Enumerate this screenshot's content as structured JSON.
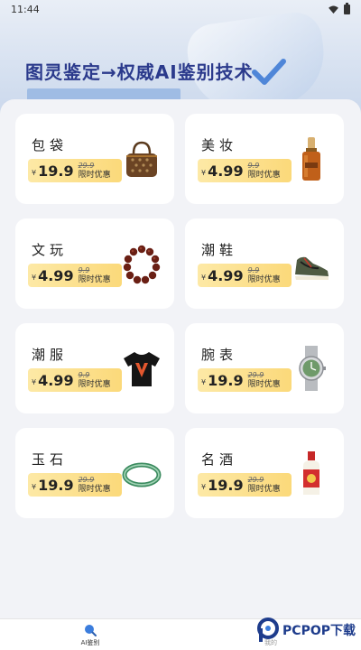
{
  "status_bar": {
    "time": "11:44"
  },
  "banner": {
    "title": "图灵鉴定→权威AI鉴别技术"
  },
  "categories": [
    {
      "name": "包袋",
      "price": "19.9",
      "original_price": "29.9",
      "promo": "限时优惠",
      "currency": "¥",
      "product_icon": "handbag-icon"
    },
    {
      "name": "美妆",
      "price": "4.99",
      "original_price": "9.9",
      "promo": "限时优惠",
      "currency": "¥",
      "product_icon": "serum-bottle-icon"
    },
    {
      "name": "文玩",
      "price": "4.99",
      "original_price": "9.9",
      "promo": "限时优惠",
      "currency": "¥",
      "product_icon": "bead-bracelet-icon"
    },
    {
      "name": "潮鞋",
      "price": "4.99",
      "original_price": "9.9",
      "promo": "限时优惠",
      "currency": "¥",
      "product_icon": "sneaker-icon"
    },
    {
      "name": "潮服",
      "price": "4.99",
      "original_price": "9.9",
      "promo": "限时优惠",
      "currency": "¥",
      "product_icon": "tshirt-icon"
    },
    {
      "name": "腕表",
      "price": "19.9",
      "original_price": "29.9",
      "promo": "限时优惠",
      "currency": "¥",
      "product_icon": "wristwatch-icon"
    },
    {
      "name": "玉石",
      "price": "19.9",
      "original_price": "29.9",
      "promo": "限时优惠",
      "currency": "¥",
      "product_icon": "jade-bangle-icon"
    },
    {
      "name": "名酒",
      "price": "19.9",
      "original_price": "29.9",
      "promo": "限时优惠",
      "currency": "¥",
      "product_icon": "liquor-bottle-icon"
    }
  ],
  "bottom_nav": {
    "items": [
      {
        "label": "AI鉴别",
        "icon": "search-icon",
        "active": true
      },
      {
        "label": "我的",
        "icon": "profile-icon",
        "active": false
      }
    ]
  },
  "watermark": {
    "text": "PCPOP下载"
  },
  "colors": {
    "title": "#2b3a8c",
    "price_tag": "#fbd97a",
    "nav_active": "#3b7ddd"
  }
}
